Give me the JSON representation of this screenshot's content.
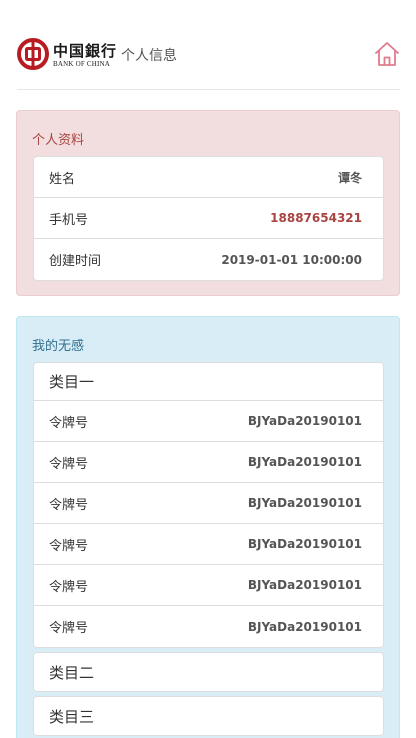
{
  "header": {
    "logo_cn": "中国銀行",
    "logo_en": "BANK OF CHINA",
    "title": "个人信息",
    "home_icon": "home-icon",
    "home_color": "#e07b8e"
  },
  "profile": {
    "title": "个人资料",
    "rows": [
      {
        "label": "姓名",
        "value": "谭冬"
      },
      {
        "label": "手机号",
        "value": "18887654321"
      },
      {
        "label": "创建时间",
        "value": "2019-01-01 10:00:00"
      }
    ]
  },
  "tokens": {
    "title": "我的无感",
    "categories": [
      {
        "name": "类目一",
        "items": [
          {
            "label": "令牌号",
            "value": "BJYaDa20190101"
          },
          {
            "label": "令牌号",
            "value": "BJYaDa20190101"
          },
          {
            "label": "令牌号",
            "value": "BJYaDa20190101"
          },
          {
            "label": "令牌号",
            "value": "BJYaDa20190101"
          },
          {
            "label": "令牌号",
            "value": "BJYaDa20190101"
          },
          {
            "label": "令牌号",
            "value": "BJYaDa20190101"
          }
        ]
      },
      {
        "name": "类目二"
      },
      {
        "name": "类目三"
      }
    ]
  },
  "colors": {
    "profile_panel_bg": "#f2dede",
    "profile_title": "#a94442",
    "tokens_panel_bg": "#d9edf7",
    "tokens_title": "#31708f",
    "brand_red": "#b81c22"
  }
}
